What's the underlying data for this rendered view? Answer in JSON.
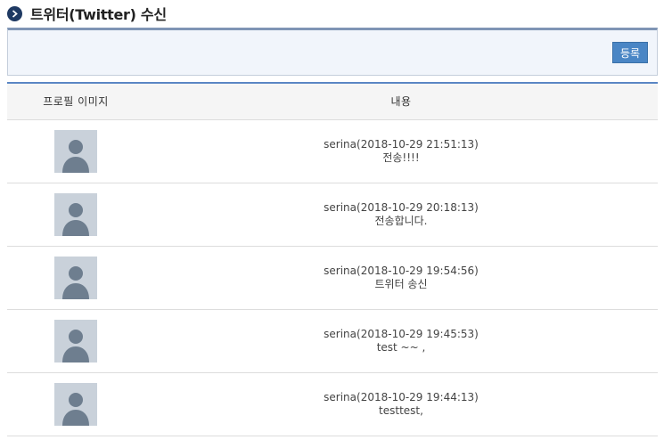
{
  "header": {
    "title": "트위터(Twitter) 수신",
    "bullet_icon": "chevron-right-icon"
  },
  "toolbar": {
    "register_label": "등록"
  },
  "table": {
    "columns": [
      "프로필 이미지",
      "내용"
    ],
    "rows": [
      {
        "author_time": "serina(2018-10-29 21:51:13)",
        "message": "전송!!!!",
        "avatar_icon": "default-profile-icon"
      },
      {
        "author_time": "serina(2018-10-29 20:18:13)",
        "message": "전송합니다.",
        "avatar_icon": "default-profile-icon"
      },
      {
        "author_time": "serina(2018-10-29 19:54:56)",
        "message": "트위터 송신",
        "avatar_icon": "default-profile-icon"
      },
      {
        "author_time": "serina(2018-10-29 19:45:53)",
        "message": "test ~~ ,",
        "avatar_icon": "default-profile-icon"
      },
      {
        "author_time": "serina(2018-10-29 19:44:13)",
        "message": "testtest,",
        "avatar_icon": "default-profile-icon"
      }
    ]
  },
  "colors": {
    "accent": "#4a86c5",
    "header_bullet": "#1f3a63",
    "avatar_bg": "#c9d1da",
    "avatar_fg": "#6e7e8f"
  }
}
